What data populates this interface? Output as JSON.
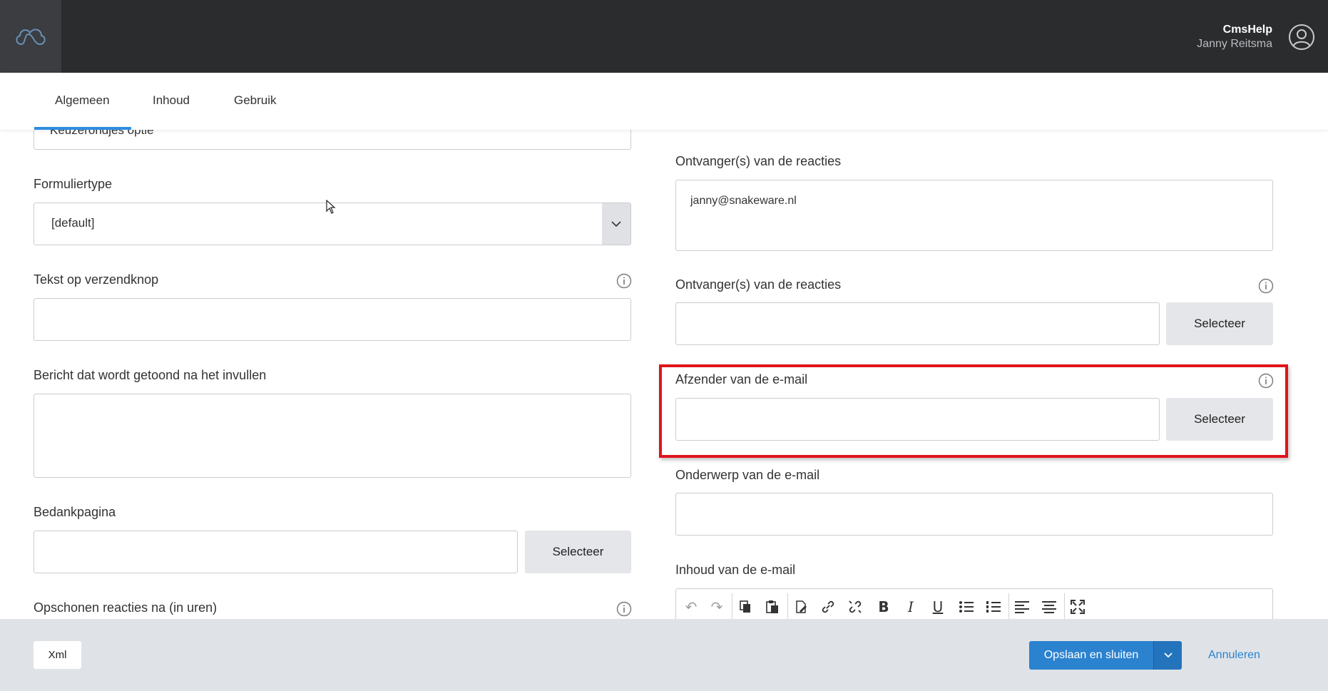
{
  "header": {
    "app_name": "CmsHelp",
    "user_name": "Janny Reitsma",
    "logo_icon": "cloud-logo-icon",
    "avatar_icon": "user-avatar-icon"
  },
  "tabs": [
    {
      "label": "Algemeen",
      "active": true
    },
    {
      "label": "Inhoud",
      "active": false
    },
    {
      "label": "Gebruik",
      "active": false
    }
  ],
  "left": {
    "top_field_value": "Keuzerondjes optie",
    "form_type": {
      "label": "Formuliertype",
      "value": "[default]"
    },
    "submit_text": {
      "label": "Tekst op verzendknop",
      "value": ""
    },
    "message_after": {
      "label": "Bericht dat wordt getoond na het invullen",
      "value": ""
    },
    "thanks_page": {
      "label": "Bedankpagina",
      "value": "",
      "button": "Selecteer"
    },
    "cleanup_hours": {
      "label": "Opschonen reacties na (in uren)"
    }
  },
  "right": {
    "recipients_text": {
      "label": "Ontvanger(s) van de reacties",
      "value": "janny@snakeware.nl"
    },
    "recipients_select": {
      "label": "Ontvanger(s) van de reacties",
      "value": "",
      "button": "Selecteer"
    },
    "sender": {
      "label": "Afzender van de e-mail",
      "value": "",
      "button": "Selecteer"
    },
    "subject": {
      "label": "Onderwerp van de e-mail",
      "value": ""
    },
    "body": {
      "label": "Inhoud van de e-mail"
    }
  },
  "editor_toolbar": [
    "undo-icon",
    "redo-icon",
    "copy-icon",
    "paste-icon",
    "clear-format-icon",
    "link-icon",
    "unlink-icon",
    "bold-icon",
    "italic-icon",
    "underline-icon",
    "bullet-list-icon",
    "numbered-list-icon",
    "align-left-icon",
    "align-center-icon",
    "fullscreen-icon"
  ],
  "footer": {
    "xml_label": "Xml",
    "save_label": "Opslaan en sluiten",
    "cancel_label": "Annuleren"
  },
  "colors": {
    "topbar": "#2b2c2e",
    "accent": "#2b82cf",
    "highlight": "#e0141b",
    "footer": "#dfe3e7"
  }
}
